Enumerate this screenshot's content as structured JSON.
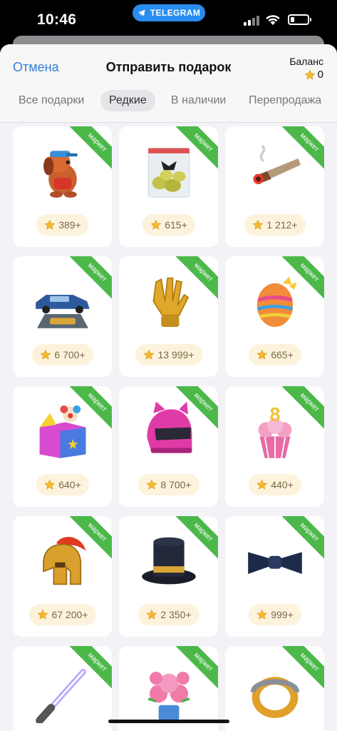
{
  "status": {
    "time": "10:46",
    "pill_label": "TELEGRAM"
  },
  "header": {
    "cancel_label": "Отмена",
    "title": "Отправить подарок",
    "balance_label": "Баланс",
    "balance_value": "0"
  },
  "tabs": [
    {
      "label": "Все подарки",
      "active": false
    },
    {
      "label": "Редкие",
      "active": true
    },
    {
      "label": "В наличии",
      "active": false
    },
    {
      "label": "Перепродажа",
      "active": false
    }
  ],
  "gifts": [
    {
      "name": "dog-gift-icon",
      "badge": "маркет",
      "price": "389+"
    },
    {
      "name": "bag-gift-icon",
      "badge": "маркет",
      "price": "615+"
    },
    {
      "name": "cigar-gift-icon",
      "badge": "маркет",
      "price": "1 212+"
    },
    {
      "name": "car-gift-icon",
      "badge": "маркет",
      "price": "6 700+"
    },
    {
      "name": "glove-gift-icon",
      "badge": "маркет",
      "price": "13 999+"
    },
    {
      "name": "egg-gift-icon",
      "badge": "маркет",
      "price": "665+"
    },
    {
      "name": "jack-box-gift-icon",
      "badge": "маркет",
      "price": "640+"
    },
    {
      "name": "helmet-gift-icon",
      "badge": "маркет",
      "price": "8 700+"
    },
    {
      "name": "cupcake-gift-icon",
      "badge": "маркет",
      "price": "440+"
    },
    {
      "name": "spartan-helmet-gift-icon",
      "badge": "маркет",
      "price": "67 200+"
    },
    {
      "name": "top-hat-gift-icon",
      "badge": "маркет",
      "price": "2 350+"
    },
    {
      "name": "bow-tie-gift-icon",
      "badge": "маркет",
      "price": "999+"
    },
    {
      "name": "lightsaber-gift-icon",
      "badge": "маркет",
      "price": ""
    },
    {
      "name": "flowers-gift-icon",
      "badge": "маркет",
      "price": ""
    },
    {
      "name": "ring-gift-icon",
      "badge": "маркет",
      "price": ""
    }
  ],
  "colors": {
    "accent": "#2f80d8",
    "ribbon": "#4cb84a",
    "price_bg": "#fdf3dc",
    "star": "#f5b92e"
  }
}
